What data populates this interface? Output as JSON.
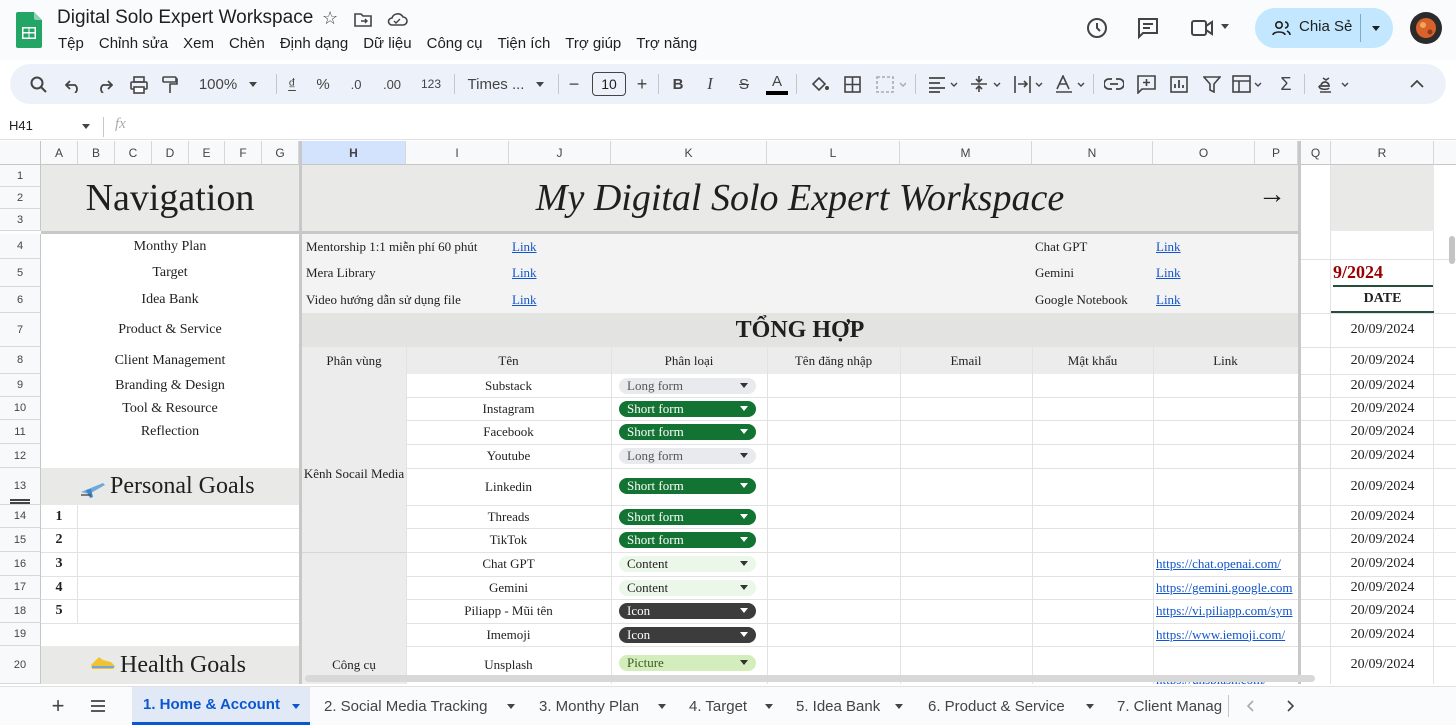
{
  "app": {
    "doc_title": "Digital Solo Expert Workspace",
    "menu": [
      "Tệp",
      "Chỉnh sửa",
      "Xem",
      "Chèn",
      "Định dạng",
      "Dữ liệu",
      "Công cụ",
      "Tiện ích",
      "Trợ giúp",
      "Trợ năng"
    ],
    "share_label": "Chia Sẻ"
  },
  "toolbar": {
    "zoom": "100%",
    "currency": "₫",
    "percent": "%",
    "dec_less": ".0",
    "dec_more": ".00",
    "number_format": "123",
    "font": "Times ...",
    "font_size": "10"
  },
  "formula_bar": {
    "cell_ref": "H41",
    "fx": "fx",
    "value": ""
  },
  "columns": [
    "A",
    "B",
    "C",
    "D",
    "E",
    "F",
    "G",
    "H",
    "I",
    "J",
    "K",
    "L",
    "M",
    "N",
    "O",
    "P",
    "Q",
    "R"
  ],
  "rows": [
    "1",
    "2",
    "3",
    "4",
    "5",
    "6",
    "7",
    "8",
    "9",
    "10",
    "11",
    "12",
    "13",
    "14",
    "15",
    "16",
    "17",
    "18",
    "19",
    "20"
  ],
  "sheet": {
    "nav_title": "Navigation",
    "main_title": "My Digital Solo Expert Workspace",
    "arrow": "→",
    "nav_items": [
      "Monthy Plan",
      "Target",
      "Idea Bank",
      "Product & Service",
      "Client Management",
      "Branding & Design",
      "Tool & Resource",
      "Reflection"
    ],
    "personal_goals": "Personal Goals",
    "health_goals": "Health Goals",
    "goal_numbers": [
      "1",
      "2",
      "3",
      "4",
      "5"
    ],
    "resources": [
      {
        "name": "Mentorship 1:1 miễn phí 60 phút",
        "link": "Link"
      },
      {
        "name": "Mera Library",
        "link": "Link"
      },
      {
        "name": "Video hướng dẫn sử dụng file",
        "link": "Link"
      }
    ],
    "ai_tools": [
      {
        "name": "Chat GPT",
        "link": "Link"
      },
      {
        "name": "Gemini",
        "link": "Link"
      },
      {
        "name": "Google Notebook",
        "link": "Link"
      }
    ],
    "summary_title": "TỔNG HỢP",
    "table_headers": [
      "Phân vùng",
      "Tên",
      "Phân loại",
      "Tên đăng nhập",
      "Email",
      "Mật khẩu",
      "Link"
    ],
    "group_social": "Kênh Socail Media",
    "group_tools": "Công cụ",
    "table_rows": [
      {
        "name": "Substack",
        "type": "Long form",
        "link": ""
      },
      {
        "name": "Instagram",
        "type": "Short form",
        "link": ""
      },
      {
        "name": "Facebook",
        "type": "Short form",
        "link": ""
      },
      {
        "name": "Youtube",
        "type": "Long form",
        "link": ""
      },
      {
        "name": "Linkedin",
        "type": "Short form",
        "link": ""
      },
      {
        "name": "Threads",
        "type": "Short form",
        "link": ""
      },
      {
        "name": "TikTok",
        "type": "Short form",
        "link": ""
      },
      {
        "name": "Chat GPT",
        "type": "Content",
        "link": "https://chat.openai.com/"
      },
      {
        "name": "Gemini",
        "type": "Content",
        "link": "https://gemini.google.com"
      },
      {
        "name": "Piliapp - Mũi tên",
        "type": "Icon",
        "link": "https://vi.piliapp.com/sym"
      },
      {
        "name": "Imemoji",
        "type": "Icon",
        "link": "https://www.iemoji.com/"
      },
      {
        "name": "Unsplash",
        "type": "Picture",
        "link": "https://unsplash.com/"
      }
    ],
    "date_month": "9/2024",
    "date_header": "DATE",
    "dates": [
      "20/09/2024",
      "20/09/2024",
      "20/09/2024",
      "20/09/2024",
      "20/09/2024",
      "20/09/2024",
      "20/09/2024",
      "20/09/2024",
      "20/09/2024",
      "20/09/2024",
      "20/09/2024",
      "20/09/2024",
      "20/09/2024",
      "20/09/2024"
    ]
  },
  "chip_colors": {
    "Long form": {
      "bg": "#e8eaed",
      "fg": "#555555"
    },
    "Short form": {
      "bg": "#137333",
      "fg": "#ffffff"
    },
    "Content": {
      "bg": "#ebf7e8",
      "fg": "#1f1f1f"
    },
    "Icon": {
      "bg": "#3c3c3c",
      "fg": "#ffffff"
    },
    "Picture": {
      "bg": "#d4edbc",
      "fg": "#3a5a1f"
    }
  },
  "tabs": [
    "1. Home & Account",
    "2. Social Media Tracking",
    "3. Monthy Plan",
    "4. Target",
    "5. Idea Bank",
    "6. Product & Service",
    "7. Client Manag"
  ],
  "active_tab_index": 0
}
